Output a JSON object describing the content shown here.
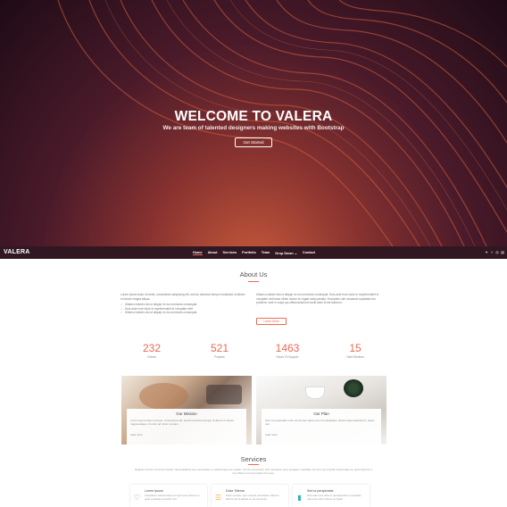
{
  "hero": {
    "title": "WELCOME TO VALERA",
    "subtitle": "We are team of talented designers making websites with Bootstrap",
    "cta": "Get Started"
  },
  "nav": {
    "logo": "VALERA",
    "items": [
      "Home",
      "About",
      "Services",
      "Portfolio",
      "Team",
      "Drop Down",
      "Contact"
    ],
    "active": "Home",
    "social_icons": [
      "twitter-icon",
      "facebook-icon",
      "instagram-icon",
      "linkedin-icon"
    ]
  },
  "about": {
    "title": "About Us",
    "left_text": "Lorem ipsum dolor sit amet, consectetur adipiscing elit, sed do eiusmod tempor incididunt ut labore et dolore magna aliqua.",
    "bullets": [
      "Ullamco laboris nisi ut aliquip ex ea commodo consequat",
      "Duis aute irure dolor in reprehenderit in voluptate velit",
      "Ullamco laboris nisi ut aliquip ex ea commodo consequat"
    ],
    "right_text": "Ullamco laboris nisi ut aliquip ex ea commodo consequat. Duis aute irure dolor in reprehenderit in voluptate velit esse cillum dolore eu fugiat nulla pariatur. Excepteur sint occaecat cupidatat non proident, sunt in culpa qui officia deserunt mollit anim id est laborum.",
    "learn_more": "Learn More"
  },
  "counters": [
    {
      "value": "232",
      "label": "Clients"
    },
    {
      "value": "521",
      "label": "Projects"
    },
    {
      "value": "1463",
      "label": "Hours Of Support"
    },
    {
      "value": "15",
      "label": "Hard Workers"
    }
  ],
  "cards": [
    {
      "title": "Our Mission",
      "text": "Lorem ipsum dolor sit amet, consectetur elit, sed do eiusmod tempor ut labore et dolore magna aliqua. Ut enim ad minim veniam.",
      "more": "read more"
    },
    {
      "title": "Our Plan",
      "text": "Sed ut perspiciatis unde omnis iste natus error sit voluptatem doloremque laudantium, totam rem.",
      "more": "read more"
    }
  ],
  "services": {
    "title": "Services",
    "intro": "Magnam dolores commodi suscipit. Necessitatibus eius consequatur ex aliquid fuga eum quidem. Sit sint consectetur velit. Quisquam quos quisquam cupiditate. Et nemo qui impedit suscipit alias ea. Quia fugiat sit in iste officiis commodi quidem hic quas.",
    "items": [
      {
        "title": "Lorem Ipsum",
        "text": "Voluptatum deleniti atque corrupti quos dolores et quas molestias excepturi sint",
        "icon": "pulse-icon",
        "color": "#e96b56"
      },
      {
        "title": "Dolor Sitema",
        "text": "Minim veniam, quis nostrud exercitation ullamco laboris nisi ut aliquip ex ea commodo",
        "icon": "file-icon",
        "color": "#f4b03e"
      },
      {
        "title": "Sed ut perspiciatis",
        "text": "Duis aute irure dolor in reprehenderit in voluptate velit esse cillum dolore eu fugiat",
        "icon": "chart-icon",
        "color": "#2bb0c4"
      }
    ]
  },
  "colors": {
    "accent": "#e96b56"
  }
}
